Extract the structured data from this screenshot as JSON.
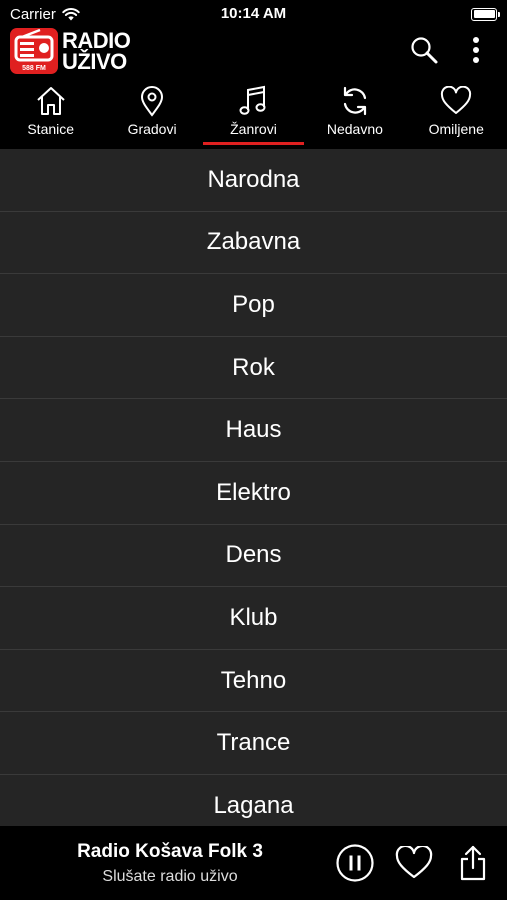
{
  "status_bar": {
    "carrier": "Carrier",
    "time": "10:14 AM"
  },
  "header": {
    "logo_line1": "RADIO",
    "logo_line2": "UŽIVO",
    "logo_badge": "588 FM"
  },
  "tabs": [
    {
      "label": "Stanice",
      "icon": "home-icon",
      "active": false
    },
    {
      "label": "Gradovi",
      "icon": "location-pin-icon",
      "active": false
    },
    {
      "label": "Žanrovi",
      "icon": "music-note-icon",
      "active": true
    },
    {
      "label": "Nedavno",
      "icon": "refresh-icon",
      "active": false
    },
    {
      "label": "Omiljene",
      "icon": "heart-icon",
      "active": false
    }
  ],
  "genres": [
    "Narodna",
    "Zabavna",
    "Pop",
    "Rok",
    "Haus",
    "Elektro",
    "Dens",
    "Klub",
    "Tehno",
    "Trance",
    "Lagana"
  ],
  "player": {
    "station": "Radio Košava Folk 3",
    "subtitle": "Slušate radio uživo"
  },
  "colors": {
    "accent": "#e02020",
    "list_bg": "#252525",
    "divider": "#3a3a3a"
  }
}
